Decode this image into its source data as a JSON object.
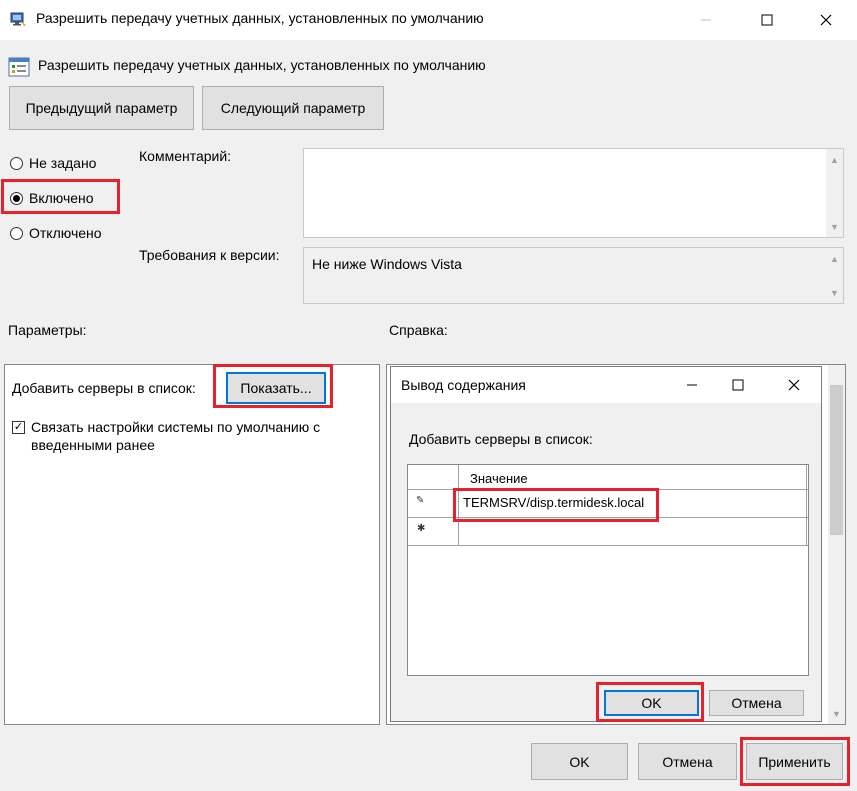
{
  "window": {
    "title": "Разрешить передачу учетных данных, установленных по умолчанию",
    "buttons": {
      "minimize": "—",
      "maximize": "☐",
      "close": "✕"
    }
  },
  "policy": {
    "name": "Разрешить передачу учетных данных, установленных по умолчанию"
  },
  "nav": {
    "previous": "Предыдущий параметр",
    "next": "Следующий параметр"
  },
  "state": {
    "options": [
      {
        "label": "Не задано",
        "checked": false
      },
      {
        "label": "Включено",
        "checked": true
      },
      {
        "label": "Отключено",
        "checked": false
      }
    ]
  },
  "comment": {
    "label": "Комментарий:",
    "value": ""
  },
  "version": {
    "label": "Требования к версии:",
    "value": "Не ниже Windows Vista"
  },
  "sections": {
    "params": "Параметры:",
    "help": "Справка:"
  },
  "params": {
    "add_servers_label": "Добавить серверы в список:",
    "show_button": "Показать...",
    "concat_checkbox_label": "Связать настройки системы по умолчанию с введенными ранее",
    "concat_checked": true
  },
  "dialog": {
    "title": "Вывод содержания",
    "label": "Добавить серверы в список:",
    "column_header": "Значение",
    "rows": [
      {
        "marker": "✎",
        "value": "TERMSRV/disp.termidesk.local"
      },
      {
        "marker": "✱",
        "value": ""
      }
    ],
    "ok": "OK",
    "cancel": "Отмена"
  },
  "footer": {
    "ok": "OK",
    "cancel": "Отмена",
    "apply": "Применить"
  },
  "colors": {
    "highlight": "#e8212f",
    "focus": "#0078d7",
    "background": "#f0f0f0"
  }
}
